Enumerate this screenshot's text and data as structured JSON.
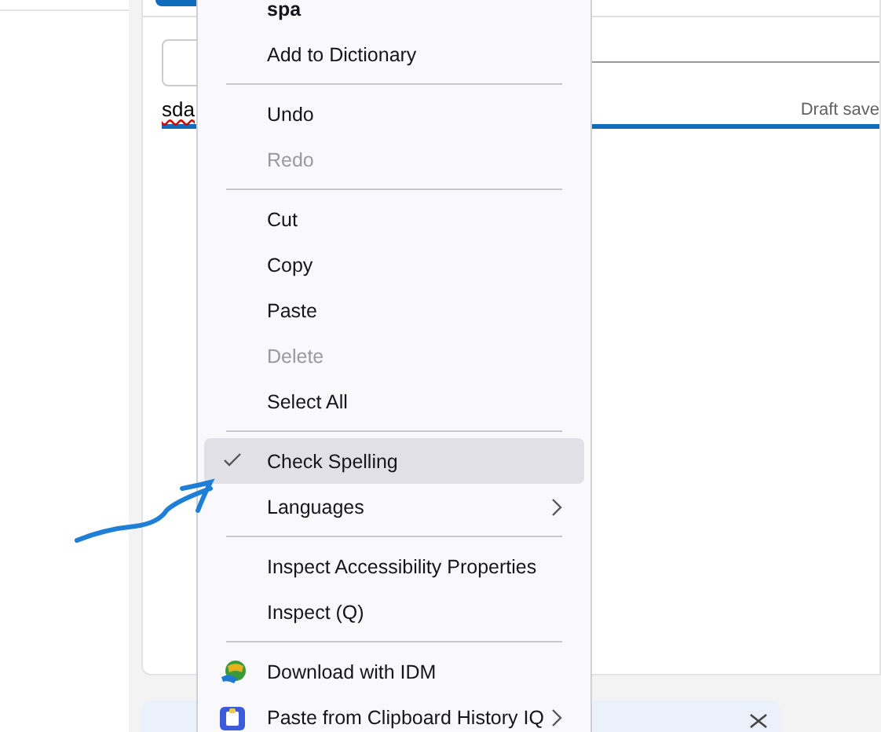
{
  "editor": {
    "text": "sda",
    "status": "Draft save"
  },
  "context_menu": {
    "items": [
      {
        "kind": "item",
        "label": "spa",
        "bold": true,
        "disabled": false
      },
      {
        "kind": "item",
        "label": "Add to Dictionary",
        "disabled": false
      },
      {
        "kind": "separator"
      },
      {
        "kind": "item",
        "label": "Undo",
        "disabled": false
      },
      {
        "kind": "item",
        "label": "Redo",
        "disabled": true
      },
      {
        "kind": "separator"
      },
      {
        "kind": "item",
        "label": "Cut",
        "disabled": false
      },
      {
        "kind": "item",
        "label": "Copy",
        "disabled": false
      },
      {
        "kind": "item",
        "label": "Paste",
        "disabled": false
      },
      {
        "kind": "item",
        "label": "Delete",
        "disabled": true
      },
      {
        "kind": "item",
        "label": "Select All",
        "disabled": false
      },
      {
        "kind": "separator"
      },
      {
        "kind": "item",
        "label": "Check Spelling",
        "checked": true,
        "selected": true,
        "disabled": false
      },
      {
        "kind": "item",
        "label": "Languages",
        "submenu": true,
        "disabled": false
      },
      {
        "kind": "separator"
      },
      {
        "kind": "item",
        "label": "Inspect Accessibility Properties",
        "disabled": false
      },
      {
        "kind": "item",
        "label": "Inspect (Q)",
        "disabled": false
      },
      {
        "kind": "separator"
      },
      {
        "kind": "extension",
        "label": "Download with IDM",
        "disabled": false
      },
      {
        "kind": "extension",
        "label": "Paste from Clipboard History IQ",
        "submenu": true,
        "disabled": false
      }
    ]
  }
}
